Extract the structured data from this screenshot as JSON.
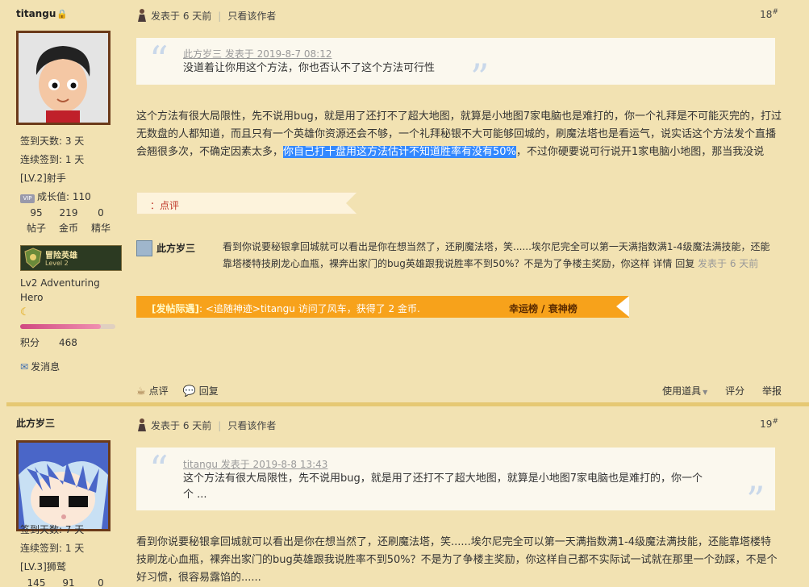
{
  "posts": [
    {
      "user": {
        "name": "titangu",
        "stats": {
          "sign_days": "签到天数: 3 天",
          "streak": "连续签到: 1 天",
          "level": "[LV.2]射手",
          "growth": "成长值: 110"
        },
        "counts": {
          "values": [
            "95",
            "219",
            "0"
          ],
          "labels": [
            "帖子",
            "金币",
            "精华"
          ]
        },
        "medal": {
          "title": "冒险英雄",
          "sub": "Level 2"
        },
        "title_text": "Lv2 Adventuring Hero",
        "level_progress": 0.85,
        "points_label": "积分",
        "points_value": "468",
        "message": "发消息"
      },
      "meta": {
        "posted": "发表于 6 天前",
        "only_author": "只看该作者",
        "floor": "18",
        "floor_mark": "#"
      },
      "quote": {
        "head": "此方岁三 发表于 2019-8-7 08:12",
        "body": "没道着让你用这个方法，你也否认不了这个方法可行性"
      },
      "body": {
        "before": "这个方法有很大局限性，先不说用bug，就是用了还打不了超大地图，就算是小地图7家电脑也是难打的，你一个礼拜是不可能灭完的，打过无数盘的人都知道，而且只有一个英雄你资源还会不够，一个礼拜秘银不大可能够回城的，刷魔法塔也是看运气，说实话这个方法发个直播会翘很多次，不确定因素太多，",
        "highlight": "你自己打十盘用这方法估计不知道胜率有没有50%",
        "after": "，不过你硬要说可行说开1家电脑小地图，那当我没说"
      },
      "rate_label": "点评",
      "comment": {
        "user": "此方岁三",
        "text": "看到你说要秘银拿回城就可以看出是你在想当然了，还刷魔法塔，笑......埃尔尼完全可以第一天满指数满1-4级魔法满技能，还能靠塔楼特技刷龙心血瓶，裸奔出家门的bug英雄跟我说胜率不到50%？不是为了争楼主奖励，你这样",
        "detail": "详情",
        "reply": "回复",
        "time": "发表于 6 天前"
      },
      "banner": {
        "tag": "[发帖际遇]",
        "text": ": <追随神迹>titangu 访问了风车，获得了 2 金币.",
        "right": "幸运榜 / 衰神榜"
      },
      "actions": {
        "comment": "点评",
        "reply": "回复",
        "tools": "使用道具",
        "rate": "评分",
        "report": "举报"
      }
    },
    {
      "user": {
        "name": "此方岁三",
        "stats": {
          "sign_days": "签到天数: 7 天",
          "streak": "连续签到: 1 天",
          "level": "[LV.3]狮鹫"
        },
        "counts": {
          "values": [
            "145",
            "91",
            "0"
          ]
        }
      },
      "meta": {
        "posted": "发表于 6 天前",
        "only_author": "只看该作者",
        "floor": "19",
        "floor_mark": "#"
      },
      "quote": {
        "head": "titangu 发表于 2019-8-8 13:43",
        "body_line1": "这个方法有很大局限性，先不说用bug，就是用了还打不了超大地图，就算是小地图7家电脑也是难打的，你一个",
        "body_line2": "个 ..."
      },
      "body": "看到你说要秘银拿回城就可以看出是你在想当然了，还刷魔法塔，笑......埃尔尼完全可以第一天满指数满1-4级魔法满技能，还能靠塔楼特技刷龙心血瓶，裸奔出家门的bug英雄跟我说胜率不到50%？不是为了争楼主奖励，你这样自己都不实际试一试就在那里一个劲踩，不是个好习惯，很容易露馅的......"
    }
  ],
  "colors": {
    "bg": "#f2e2b2",
    "banner": "#f7a21b",
    "highlight": "#3388ff",
    "link": "#c0392b"
  }
}
